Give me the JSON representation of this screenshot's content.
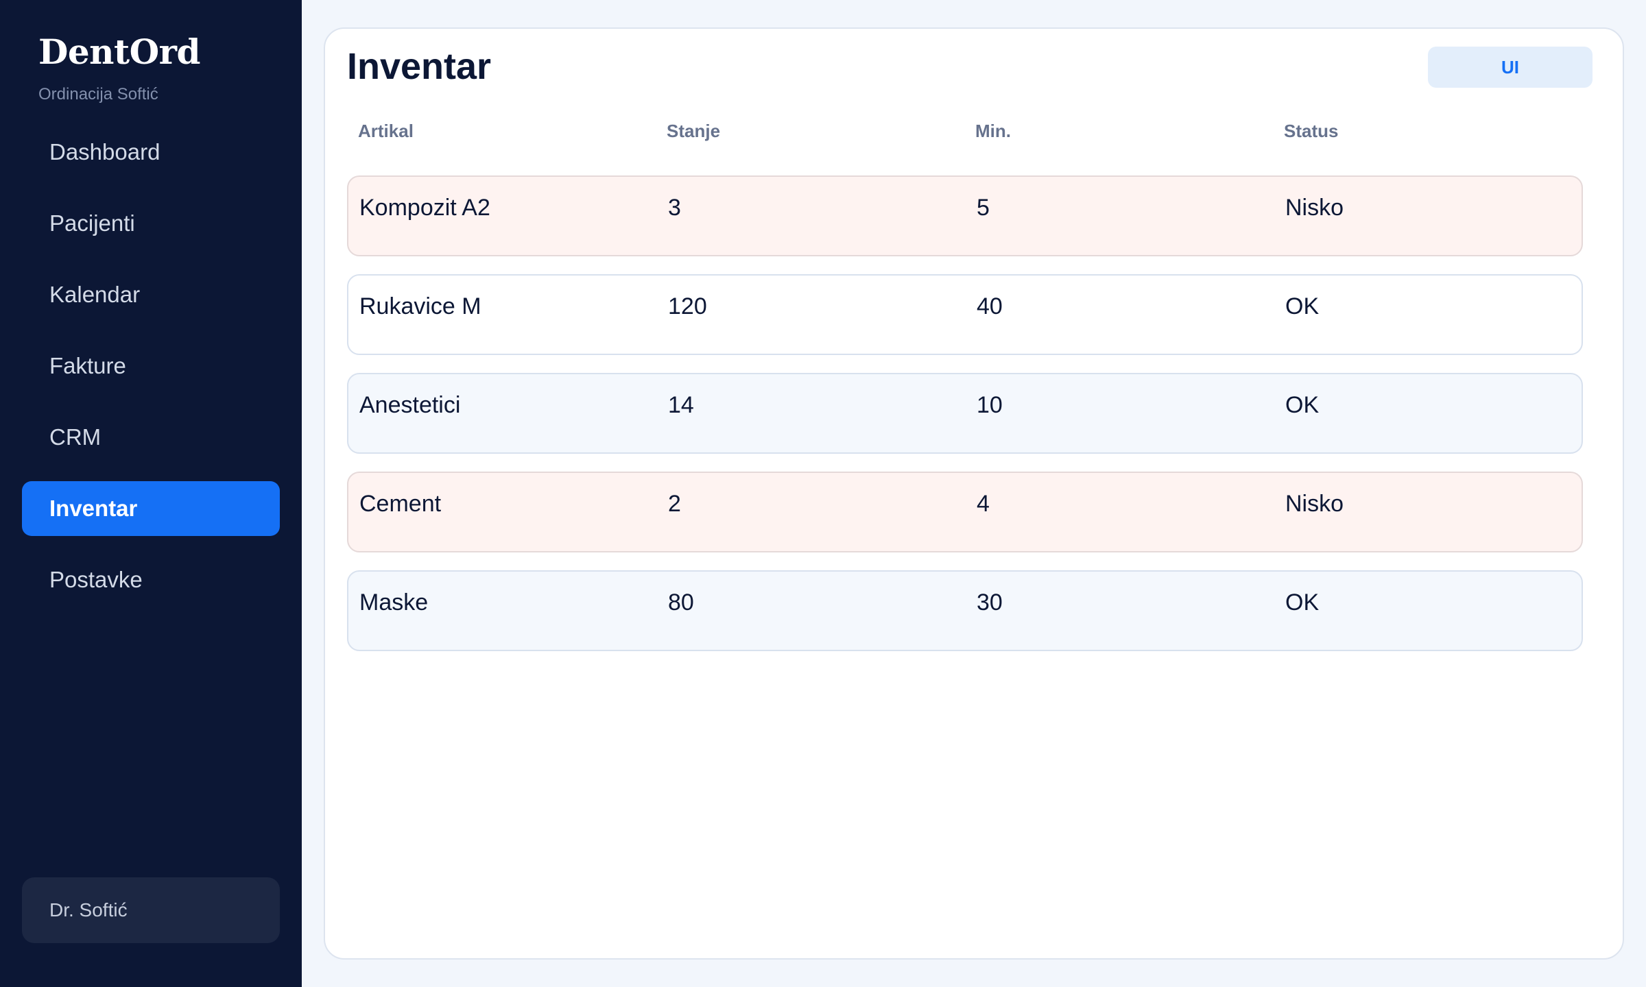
{
  "sidebar": {
    "brand": "DentOrd",
    "subtitle": "Ordinacija Softić",
    "items": [
      {
        "label": "Dashboard",
        "active": false
      },
      {
        "label": "Pacijenti",
        "active": false
      },
      {
        "label": "Kalendar",
        "active": false
      },
      {
        "label": "Fakture",
        "active": false
      },
      {
        "label": "CRM",
        "active": false
      },
      {
        "label": "Inventar",
        "active": true
      },
      {
        "label": "Postavke",
        "active": false
      }
    ],
    "user": "Dr. Softić"
  },
  "main": {
    "title": "Inventar",
    "action_button": "UI",
    "columns": [
      "Artikal",
      "Stanje",
      "Min.",
      "Status"
    ],
    "rows": [
      {
        "artikal": "Kompozit A2",
        "stanje": "3",
        "min": "5",
        "status": "Nisko"
      },
      {
        "artikal": "Rukavice M",
        "stanje": "120",
        "min": "40",
        "status": "OK"
      },
      {
        "artikal": "Anestetici",
        "stanje": "14",
        "min": "10",
        "status": "OK"
      },
      {
        "artikal": "Cement",
        "stanje": "2",
        "min": "4",
        "status": "Nisko"
      },
      {
        "artikal": "Maske",
        "stanje": "80",
        "min": "30",
        "status": "OK"
      }
    ]
  },
  "colors": {
    "sidebar_bg": "#0c1735",
    "accent": "#1570f5",
    "low_row_bg": "#fef3f1",
    "row_bg": "#f4f8fd"
  }
}
